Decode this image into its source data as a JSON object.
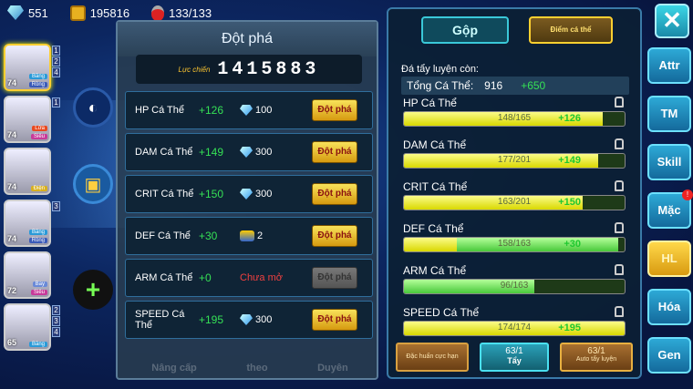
{
  "resources": {
    "gems": "551",
    "gold": "195816",
    "stamina": "133/133"
  },
  "pets": [
    {
      "level": "74",
      "tags": [
        "Băng",
        "Rồng"
      ],
      "nums": [
        "1",
        "2",
        "4"
      ],
      "selected": true
    },
    {
      "level": "74",
      "tags": [
        "Lửa",
        "Siêu"
      ],
      "nums": [
        "1"
      ]
    },
    {
      "level": "74",
      "tags": [
        "Điện"
      ],
      "nums": []
    },
    {
      "level": "74",
      "tags": [
        "Băng",
        "Rồng"
      ],
      "nums": [
        "3"
      ]
    },
    {
      "level": "72",
      "tags": [
        "Bay",
        "Siêu"
      ],
      "nums": []
    },
    {
      "level": "65",
      "tags": [
        "Băng"
      ],
      "nums": [
        "2",
        "3",
        "4"
      ]
    }
  ],
  "breakthrough": {
    "title": "Đột phá",
    "power_label": "Lực chiến",
    "power_value": "1415883",
    "rows": [
      {
        "name": "HP Cá Thể",
        "bonus": "+126",
        "cost": "100",
        "cost_icon": "gem-icon",
        "button": "Đột phá",
        "enabled": true
      },
      {
        "name": "DAM Cá Thể",
        "bonus": "+149",
        "cost": "300",
        "cost_icon": "gem-icon",
        "button": "Đột phá",
        "enabled": true
      },
      {
        "name": "CRIT Cá Thể",
        "bonus": "+150",
        "cost": "300",
        "cost_icon": "gem-icon",
        "button": "Đột phá",
        "enabled": true
      },
      {
        "name": "DEF Cá Thể",
        "bonus": "+30",
        "cost": "2",
        "cost_icon": "item-icon",
        "button": "Đột phá",
        "enabled": true
      },
      {
        "name": "ARM Cá Thể",
        "bonus": "+0",
        "cost": "Chưa mở",
        "cost_icon": "",
        "button": "Đột phá",
        "enabled": false
      },
      {
        "name": "SPEED Cá Thể",
        "bonus": "+195",
        "cost": "300",
        "cost_icon": "gem-icon",
        "button": "Đột phá",
        "enabled": true
      }
    ],
    "bottom_tabs": [
      "Nâng cấp",
      "theo",
      "Duyên"
    ]
  },
  "train": {
    "tab_merge": "Gộp",
    "tab_points": "Điểm cá thể",
    "remain_label": "Đá tẩy luyện còn:",
    "total_label": "Tổng Cá Thể:",
    "total_value": "916",
    "total_bonus": "+650",
    "stats": [
      {
        "name": "HP Cá Thể",
        "value": "148/165",
        "add": "+126",
        "fill": 0.9,
        "fill2": 0
      },
      {
        "name": "DAM Cá Thể",
        "value": "177/201",
        "add": "+149",
        "fill": 0.88,
        "fill2": 0
      },
      {
        "name": "CRIT Cá Thể",
        "value": "163/201",
        "add": "+150",
        "fill": 0.81,
        "fill2": 0
      },
      {
        "name": "DEF Cá Thể",
        "value": "158/163",
        "add": "+30",
        "fill": 0.24,
        "fill2": 0.97
      },
      {
        "name": "ARM Cá Thể",
        "value": "96/163",
        "add": "",
        "fill": 0,
        "fill2": 0.59
      },
      {
        "name": "SPEED Cá Thể",
        "value": "174/174",
        "add": "+195",
        "fill": 1.0,
        "fill2": 0
      }
    ],
    "btn_special": "Đặc huấn cực hạn",
    "btn_wash_count": "63/1",
    "btn_wash": "Tẩy",
    "btn_auto_count": "63/1",
    "btn_auto": "Auto tẩy luyện"
  },
  "side_menu": [
    "Attr",
    "TM",
    "Skill",
    "Mặc",
    "HL",
    "Hóa",
    "Gen"
  ],
  "side_active": "HL",
  "close_label": "✕"
}
